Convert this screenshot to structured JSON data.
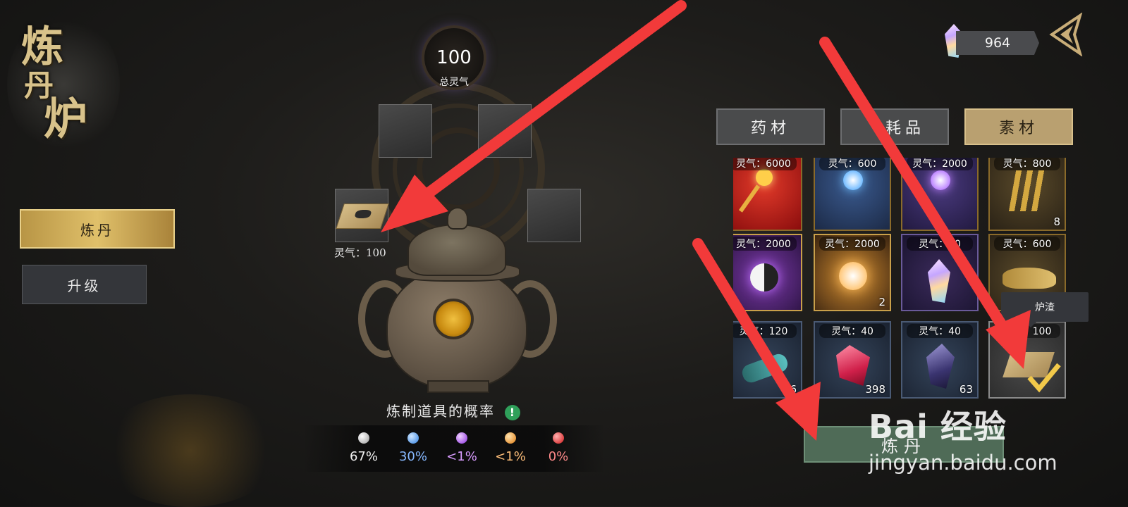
{
  "title": {
    "chars": [
      "炼",
      "丹",
      "炉"
    ]
  },
  "spirit": {
    "value": "100",
    "label": "总灵气"
  },
  "left_menu": {
    "items": [
      {
        "label": "炼丹",
        "active": true
      },
      {
        "label": "升级",
        "active": false
      }
    ]
  },
  "slot_item": {
    "label": "灵气：100"
  },
  "probability": {
    "title": "炼制道具的概率",
    "entries": [
      {
        "orb": "white-orb",
        "color": "#e8e8e8",
        "value": "67%"
      },
      {
        "orb": "blue-orb",
        "color": "#5aa8ff",
        "value": "30%"
      },
      {
        "orb": "purple-orb",
        "color": "#b65cff",
        "value": "<1%"
      },
      {
        "orb": "orange-orb",
        "color": "#ff9c2a",
        "value": "<1%"
      },
      {
        "orb": "red-orb",
        "color": "#ff3b3b",
        "value": "0%"
      }
    ]
  },
  "currency": {
    "value": "964"
  },
  "tabs": [
    {
      "label": "药材",
      "active": false
    },
    {
      "label": "耗品",
      "active": false
    },
    {
      "label": "素材",
      "active": true
    }
  ],
  "grid": {
    "rows": [
      [
        {
          "label": "灵气：6000",
          "count": "",
          "art": "golden-staff-icon"
        },
        {
          "label": "灵气：600",
          "count": "",
          "art": "blue-orb-staff-icon"
        },
        {
          "label": "灵气：2000",
          "count": "",
          "art": "purple-orb-staff-icon"
        },
        {
          "label": "灵气：800",
          "count": "8",
          "art": "golden-claws-icon"
        }
      ],
      [
        {
          "label": "灵气：2000",
          "count": "",
          "art": "yin-yang-orb-icon"
        },
        {
          "label": "灵气：2000",
          "count": "2",
          "art": "golden-orb-icon"
        },
        {
          "label": "灵气：30",
          "count": "",
          "art": "rainbow-crystal-icon"
        },
        {
          "label": "灵气：600",
          "count": "",
          "art": "golden-leopard-icon"
        }
      ],
      [
        {
          "label": "灵气：120",
          "count": "6",
          "art": "jade-log-icon"
        },
        {
          "label": "灵气：40",
          "count": "398",
          "art": "red-gem-icon"
        },
        {
          "label": "灵气：40",
          "count": "63",
          "art": "dark-crystal-icon"
        },
        {
          "label": "灵气：100",
          "count": "",
          "art": "furnace-slag-icon"
        }
      ]
    ]
  },
  "tooltip": {
    "text": "炉渣"
  },
  "refine_button": {
    "label": "炼丹"
  },
  "watermark": {
    "brand": "Bai 经验",
    "url": "jingyan.baidu.com"
  }
}
